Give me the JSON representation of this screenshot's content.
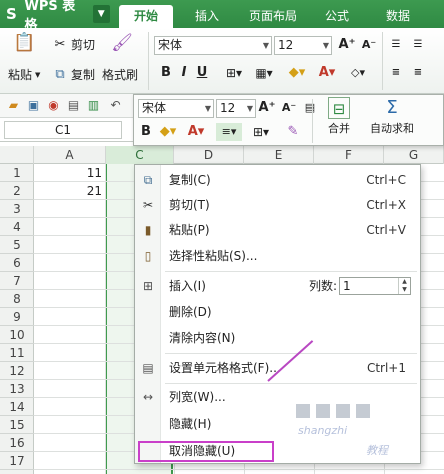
{
  "app": {
    "logo_text": "WPS 表格",
    "brand_color": "#2f8a43",
    "tabs": [
      {
        "label": "开始",
        "active": true
      },
      {
        "label": "插入",
        "active": false
      },
      {
        "label": "页面布局",
        "active": false
      },
      {
        "label": "公式",
        "active": false
      },
      {
        "label": "数据",
        "active": false
      }
    ]
  },
  "ribbon": {
    "paste_label": "粘贴",
    "cut_label": "剪切",
    "copy_label": "复制",
    "format_painter_label": "格式刷",
    "font_name": "宋体",
    "font_size": "12",
    "bold": "B",
    "italic": "I",
    "underline": "U",
    "grow_font": "A⁺",
    "shrink_font": "A⁻"
  },
  "name_box": "C1",
  "mini_toolbar": {
    "font_name": "宋体",
    "font_size": "12",
    "merge_label": "合并",
    "autosum_label": "自动求和"
  },
  "grid": {
    "columns": [
      "A",
      "C",
      "D",
      "E",
      "F",
      "G"
    ],
    "selected_column": "C",
    "rows": [
      "1",
      "2",
      "3",
      "4",
      "5",
      "6",
      "7",
      "8",
      "9",
      "10",
      "11",
      "12",
      "13",
      "14",
      "15",
      "16",
      "17"
    ],
    "cells": [
      {
        "ref": "A1",
        "value": "11"
      },
      {
        "ref": "A2",
        "value": "21"
      }
    ]
  },
  "context_menu": {
    "items": [
      {
        "label": "复制(C)",
        "shortcut": "Ctrl+C",
        "icon": "copy-icon"
      },
      {
        "label": "剪切(T)",
        "shortcut": "Ctrl+X",
        "icon": "cut-icon"
      },
      {
        "label": "粘贴(P)",
        "shortcut": "Ctrl+V",
        "icon": "paste-icon"
      },
      {
        "label": "选择性粘贴(S)...",
        "shortcut": "",
        "icon": "paste-special-icon"
      },
      {
        "label": "插入(I)",
        "shortcut": "",
        "icon": "insert-icon"
      },
      {
        "label": "删除(D)",
        "shortcut": "",
        "icon": ""
      },
      {
        "label": "清除内容(N)",
        "shortcut": "",
        "icon": ""
      },
      {
        "label": "设置单元格格式(F)...",
        "shortcut": "Ctrl+1",
        "icon": "format-cells-icon"
      },
      {
        "label": "列宽(W)...",
        "shortcut": "",
        "icon": "column-width-icon"
      },
      {
        "label": "隐藏(H)",
        "shortcut": "",
        "icon": ""
      },
      {
        "label": "取消隐藏(U)",
        "shortcut": "",
        "icon": ""
      }
    ],
    "column_count_label": "列数:",
    "column_count_value": "1",
    "highlight_color": "#c93fc9"
  },
  "watermark": {
    "text": "shangzhi",
    "subtext": "教程"
  }
}
